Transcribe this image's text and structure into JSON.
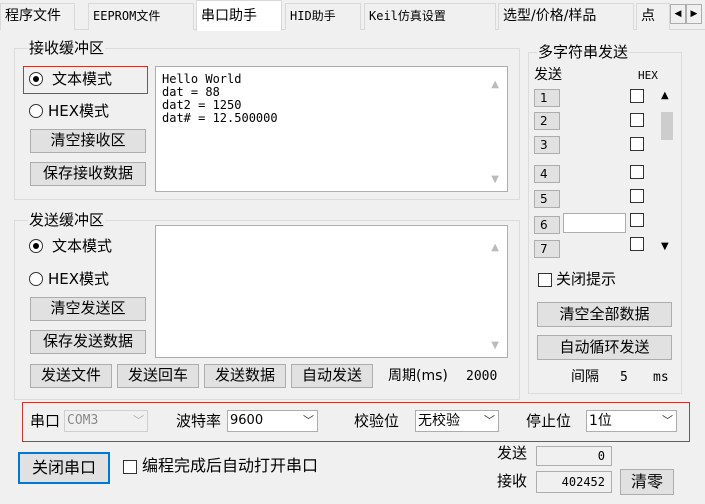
{
  "tabs": [
    {
      "label": "程序文件"
    },
    {
      "label": "EEPROM文件"
    },
    {
      "label": "串口助手"
    },
    {
      "label": "HID助手"
    },
    {
      "label": "Keil仿真设置"
    },
    {
      "label": "选型/价格/样品"
    },
    {
      "label": "点"
    }
  ],
  "receive": {
    "group_label": "接收缓冲区",
    "text_mode": "文本模式",
    "hex_mode": "HEX模式",
    "clear_button": "清空接收区",
    "save_button": "保存接收数据",
    "lines": [
      "Hello World",
      "dat = 88",
      "dat2 = 1250",
      "dat# = 12.500000"
    ]
  },
  "send": {
    "group_label": "发送缓冲区",
    "text_mode": "文本模式",
    "hex_mode": "HEX模式",
    "clear_button": "清空发送区",
    "save_button": "保存发送数据",
    "send_file": "发送文件",
    "send_enter": "发送回车",
    "send_data": "发送数据",
    "auto_send": "自动发送",
    "period_label": "周期(ms)",
    "period_value": "2000"
  },
  "multi": {
    "group_label": "多字符串发送",
    "col_send": "发送",
    "col_hex": "HEX",
    "rows": [
      "1",
      "2",
      "3",
      "4",
      "5",
      "6",
      "7"
    ],
    "close_hint": "关闭提示",
    "clear_all": "清空全部数据",
    "auto_loop": "自动循环发送",
    "interval_label": "间隔",
    "interval_value": "5",
    "interval_unit": "ms"
  },
  "settings": {
    "port_label": "串口",
    "port_value": "COM3",
    "baud_label": "波特率",
    "baud_value": "9600",
    "parity_label": "校验位",
    "parity_value": "无校验",
    "stop_label": "停止位",
    "stop_value": "1位"
  },
  "bottom": {
    "close_port": "关闭串口",
    "auto_open": "编程完成后自动打开串口",
    "sent_label": "发送",
    "sent_value": "0",
    "recv_label": "接收",
    "recv_value": "402452",
    "clear_counts": "清零"
  }
}
